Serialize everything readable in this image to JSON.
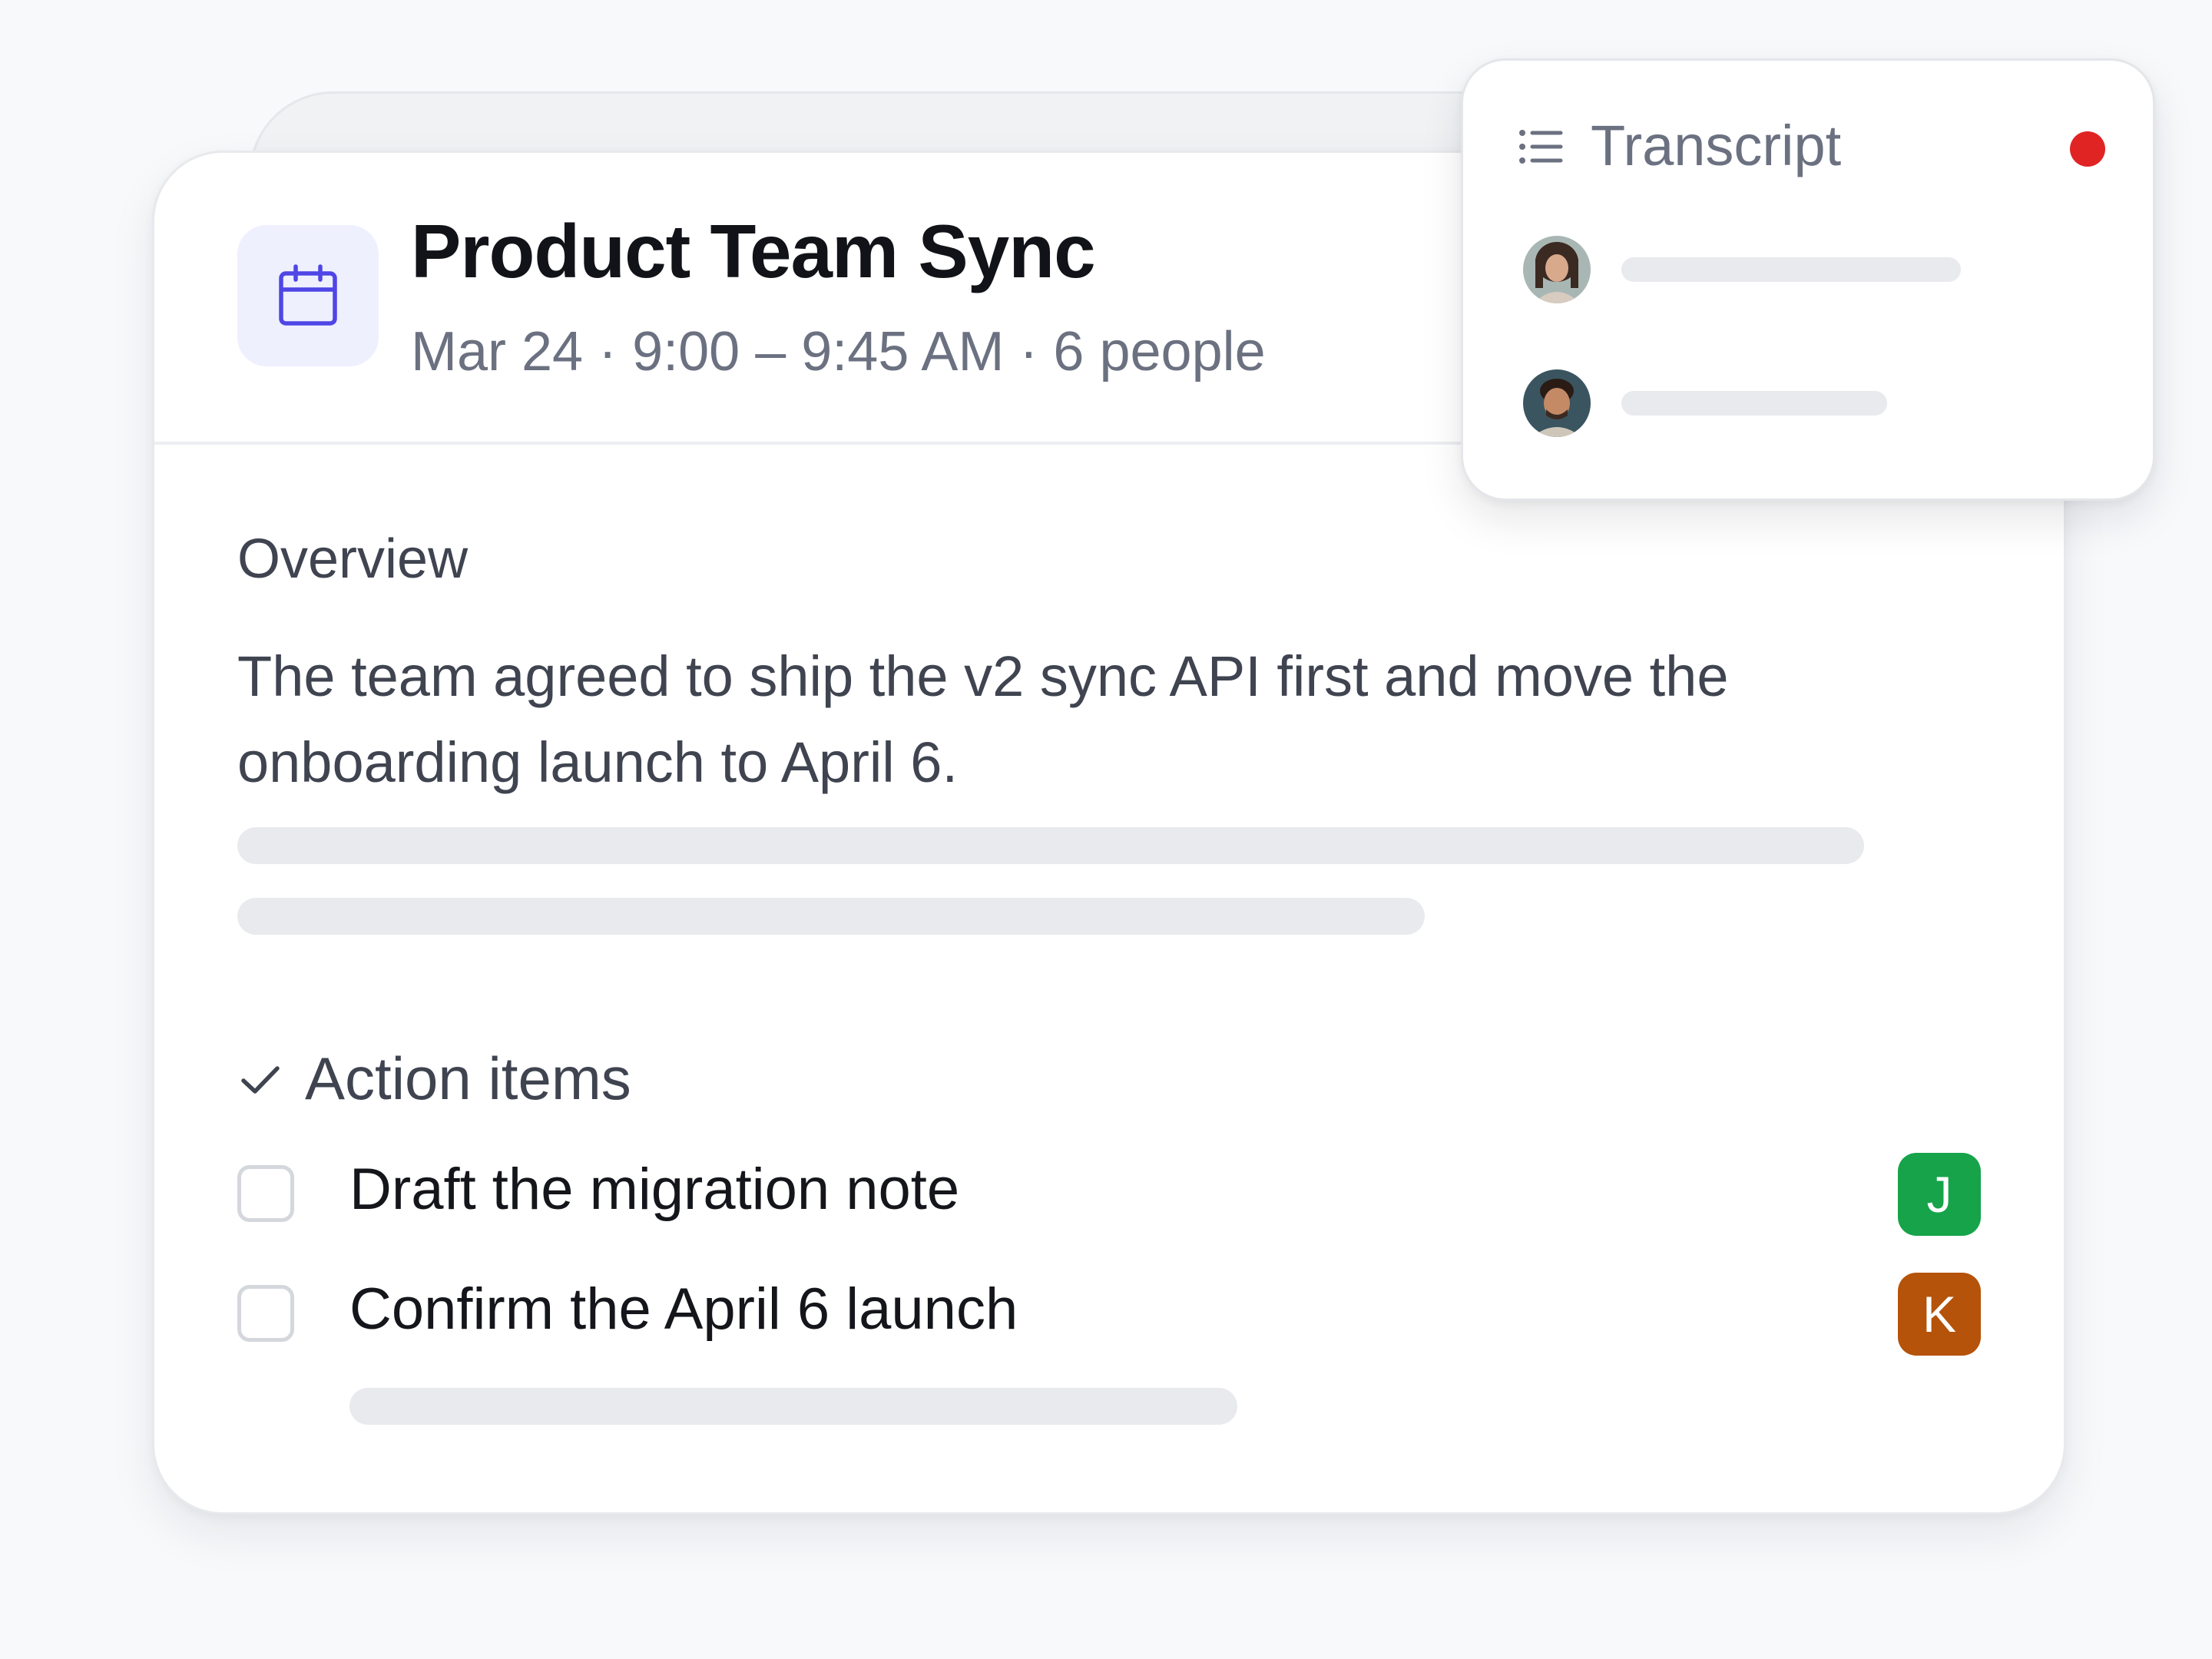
{
  "meeting": {
    "title": "Product Team Sync",
    "meta": "Mar 24 · 9:00 – 9:45 AM · 6 people",
    "icon": "calendar-icon"
  },
  "overview": {
    "label": "Overview",
    "text": "The team agreed to ship the v2 sync API first and move the onboarding launch to April 6."
  },
  "actions": {
    "label": "Action items",
    "icon": "check-icon",
    "items": [
      {
        "text": "Draft the migration note",
        "assignee": "J",
        "assignee_color": "#16a34a",
        "checked": false
      },
      {
        "text": "Confirm the April 6 launch",
        "assignee": "K",
        "assignee_color": "#b45309",
        "checked": false
      }
    ]
  },
  "transcript": {
    "title": "Transcript",
    "icon": "list-icon",
    "recording_color": "#e02424"
  },
  "colors": {
    "accent": "#4f46e5",
    "accent_tile": "#eef0fe",
    "skeleton": "#e9eaed"
  }
}
